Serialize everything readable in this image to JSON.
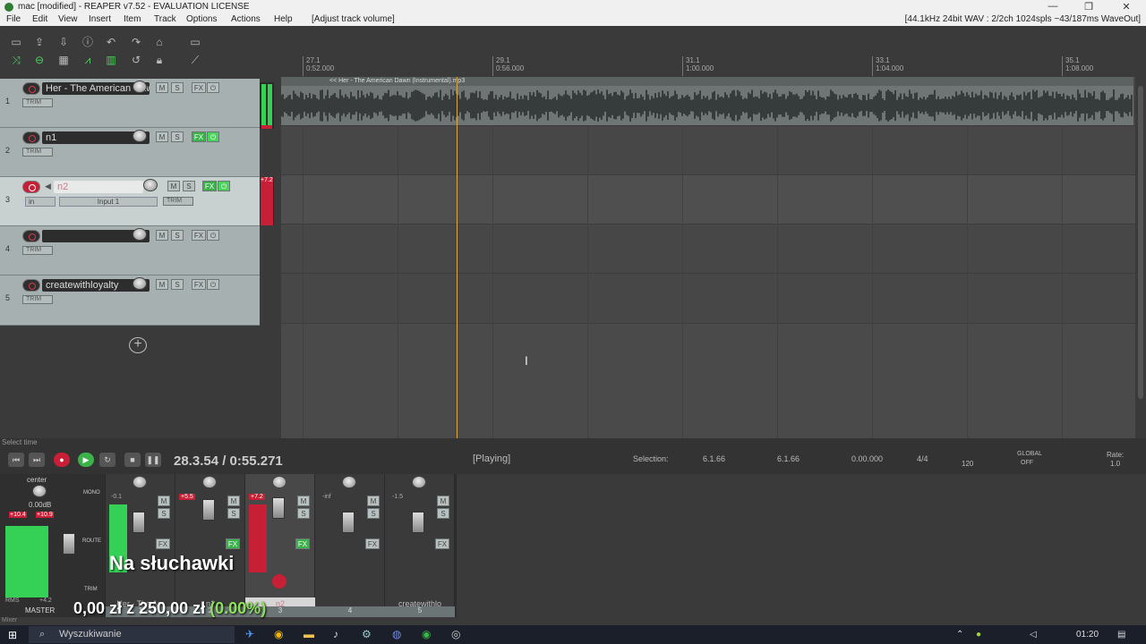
{
  "window": {
    "title": "mac [modified] - REAPER v7.52 - EVALUATION LICENSE",
    "min": "—",
    "max": "❐",
    "close": "✕"
  },
  "menu": {
    "items": [
      "File",
      "Edit",
      "View",
      "Insert",
      "Item",
      "Track",
      "Options",
      "Actions",
      "Help"
    ],
    "action": "[Adjust track volume]",
    "status": "[44.1kHz 24bit WAV : 2/2ch 1024spls ~43/187ms WaveOut]"
  },
  "ruler": {
    "markers": [
      {
        "bar": "27.1",
        "time": "0:52.000"
      },
      {
        "bar": "29.1",
        "time": "0:56.000"
      },
      {
        "bar": "31.1",
        "time": "1:00.000"
      },
      {
        "bar": "33.1",
        "time": "1:04.000"
      },
      {
        "bar": "35.1",
        "time": "1:08.000"
      }
    ]
  },
  "tracks": [
    {
      "num": "1",
      "name": "Her - The American Dawn",
      "trim": "TRIM"
    },
    {
      "num": "2",
      "name": "n1",
      "trim": "TRIM"
    },
    {
      "num": "3",
      "name": "n2",
      "trim": "TRIM",
      "input": "Input 1",
      "in_label": "in",
      "meter_peak": "+7.2"
    },
    {
      "num": "4",
      "name": "",
      "trim": "TRIM"
    },
    {
      "num": "5",
      "name": "createwithloyalty",
      "trim": "TRIM"
    }
  ],
  "buttons": {
    "m": "M",
    "s": "S",
    "fx": "FX",
    "phase": "⏻"
  },
  "item": {
    "label": "<< Her - The American Dawn (Instrumental).mp3"
  },
  "transport": {
    "select_time": "Select time",
    "time": "28.3.54 / 0:55.271",
    "state": "[Playing]",
    "selection_label": "Selection:",
    "sel_start": "6.1.66",
    "sel_end": "6.1.66",
    "sel_len": "0.00.000",
    "time_sig": "4/4",
    "bpm": "120",
    "global": "GLOBAL",
    "global_state": "OFF",
    "rate_label": "Rate:",
    "rate": "1.0"
  },
  "mixer": {
    "master": {
      "pan": "center",
      "vol": "0.00dB",
      "peak_l": "+10.4",
      "peak_r": "+10.9",
      "rms": "RMS",
      "rms_val": "+4.2",
      "label": "MASTER",
      "mono": "MONO",
      "route": "ROUTE",
      "trim": "TRIM",
      "mixer_tab": "Mixer"
    },
    "strips": [
      {
        "name": "Her - The Am",
        "peak": "-0.1",
        "num": "1"
      },
      {
        "name": "n1",
        "peak": "+5.5",
        "num": "2"
      },
      {
        "name": "n2",
        "peak": "+7.2",
        "num": "3"
      },
      {
        "name": "",
        "peak": "-inf",
        "num": "4"
      },
      {
        "name": "createwithlo",
        "peak": "-1.5",
        "num": "5"
      }
    ]
  },
  "overlay": {
    "line1": "Na słuchawki",
    "amount": "0,00 zł",
    "z": "z",
    "goal": "250,00 zł",
    "pct": "(0.00%)"
  },
  "taskbar": {
    "search": "Wyszukiwanie",
    "clock": "01:20"
  },
  "colors": {
    "accent_green": "#4ad35c",
    "rec_red": "#c71f35",
    "cursor": "#d9a94a"
  }
}
